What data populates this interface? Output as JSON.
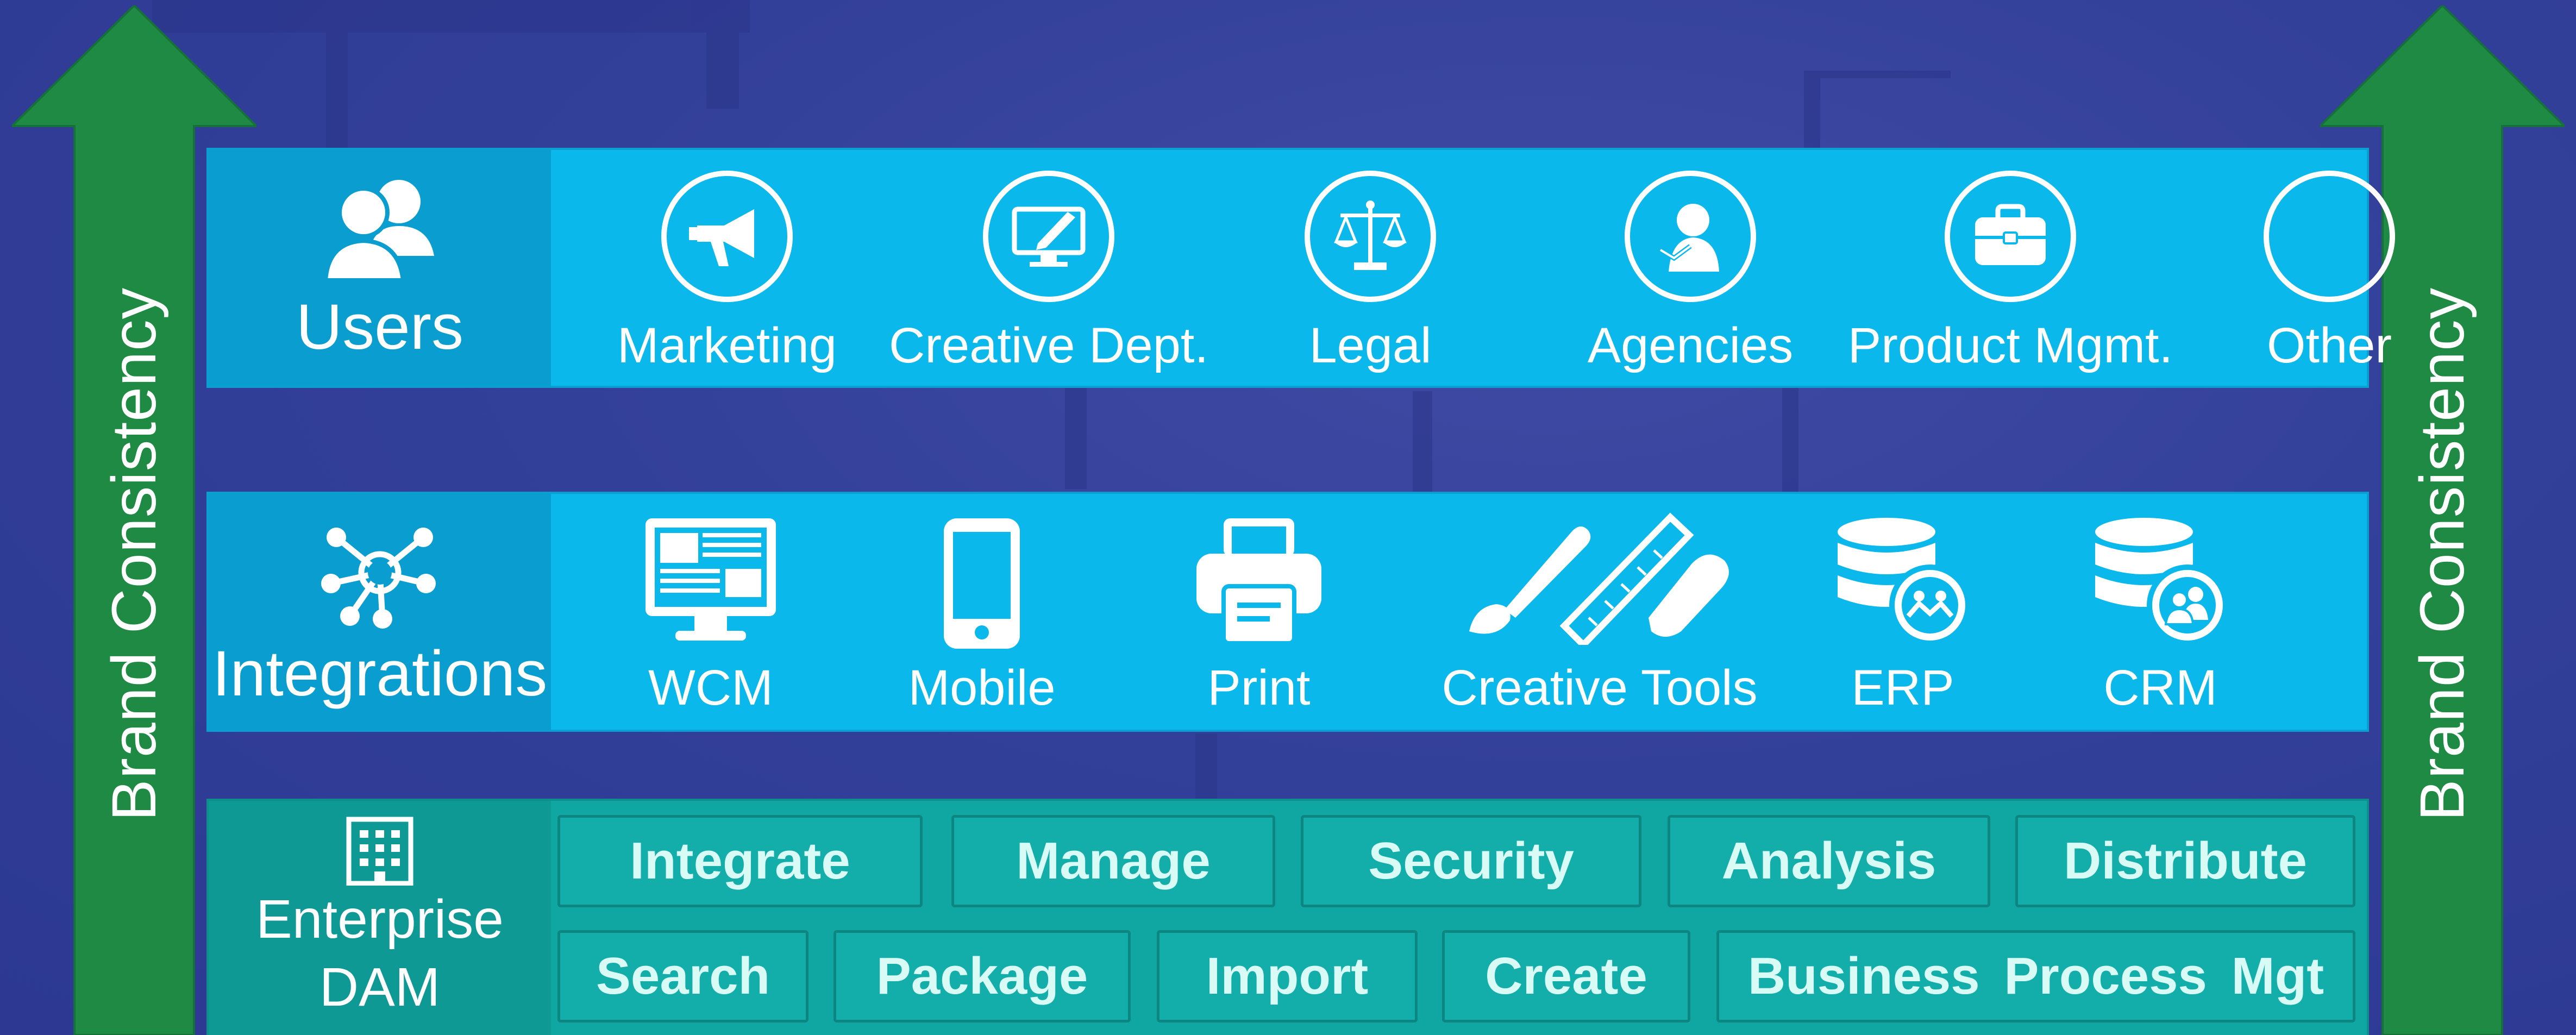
{
  "side_arrows": {
    "left_label": "Brand Consistency",
    "right_label": "Brand Consistency",
    "color": "#1f8a44"
  },
  "users": {
    "title": "Users",
    "items": [
      {
        "label": "Marketing",
        "icon": "megaphone-icon"
      },
      {
        "label": "Creative Dept.",
        "icon": "monitor-pen-icon"
      },
      {
        "label": "Legal",
        "icon": "scales-icon"
      },
      {
        "label": "Agencies",
        "icon": "person-handshake-icon"
      },
      {
        "label": "Product Mgmt.",
        "icon": "briefcase-icon"
      },
      {
        "label": "Other",
        "icon": "empty-circle-icon"
      }
    ],
    "color": "#0bb8ec"
  },
  "integrations": {
    "title": "Integrations",
    "items": [
      {
        "label": "WCM",
        "icon": "web-monitor-icon"
      },
      {
        "label": "Mobile",
        "icon": "smartphone-icon"
      },
      {
        "label": "Print",
        "icon": "printer-icon"
      },
      {
        "label": "Creative Tools",
        "icon": "brush-ruler-icon"
      },
      {
        "label": "ERP",
        "icon": "database-people-icon"
      },
      {
        "label": "CRM",
        "icon": "database-users-icon"
      }
    ]
  },
  "enterprise_dam": {
    "title_line1": "Enterprise",
    "title_line2": "DAM",
    "row1": [
      "Integrate",
      "Manage",
      "Security",
      "Analysis",
      "Distribute"
    ],
    "row2": [
      "Search",
      "Package",
      "Import",
      "Create",
      "Business Process Mgt"
    ],
    "color": "#10a7a3"
  }
}
